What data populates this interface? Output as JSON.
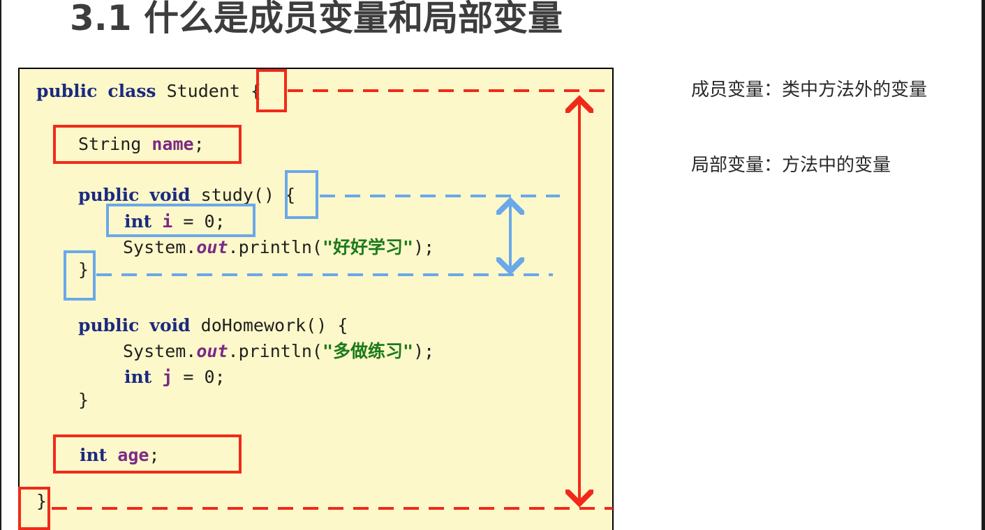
{
  "title": "3.1 什么是成员变量和局部变量",
  "code": {
    "l1": {
      "kw1": "public",
      "kw2": "class",
      "name": "Student",
      "brace": "{"
    },
    "l2": {
      "type": "String",
      "var": "name",
      "end": ";"
    },
    "l3": {
      "kw1": "public",
      "kw2": "void",
      "method": "study()",
      "brace": "{"
    },
    "l4": {
      "kw": "int",
      "var": "i",
      "rest": " = 0;"
    },
    "l5": {
      "obj": "System.",
      "field": "out",
      "call": ".println(",
      "str": "\"好好学习\"",
      "end": ");"
    },
    "l6": {
      "brace": "}"
    },
    "l7": {
      "kw1": "public",
      "kw2": "void",
      "method": "doHomework()",
      "brace": "{"
    },
    "l8": {
      "obj": "System.",
      "field": "out",
      "call": ".println(",
      "str": "\"多做练习\"",
      "end": ");"
    },
    "l9": {
      "kw": "int",
      "var": "j",
      "rest": " = 0;"
    },
    "l10": {
      "brace": "}"
    },
    "l11": {
      "kw": "int",
      "var": "age",
      "end": ";"
    },
    "l12": {
      "brace": "}"
    }
  },
  "notes": {
    "member": "成员变量：类中方法外的变量",
    "local": "局部变量：方法中的变量"
  },
  "colors": {
    "member_scope": "#f02a1a",
    "local_scope": "#6aa8ea",
    "code_background": "#fdf8c9",
    "keyword": "#1b2a80",
    "variable": "#7a2a86",
    "string": "#1c7a1c"
  }
}
